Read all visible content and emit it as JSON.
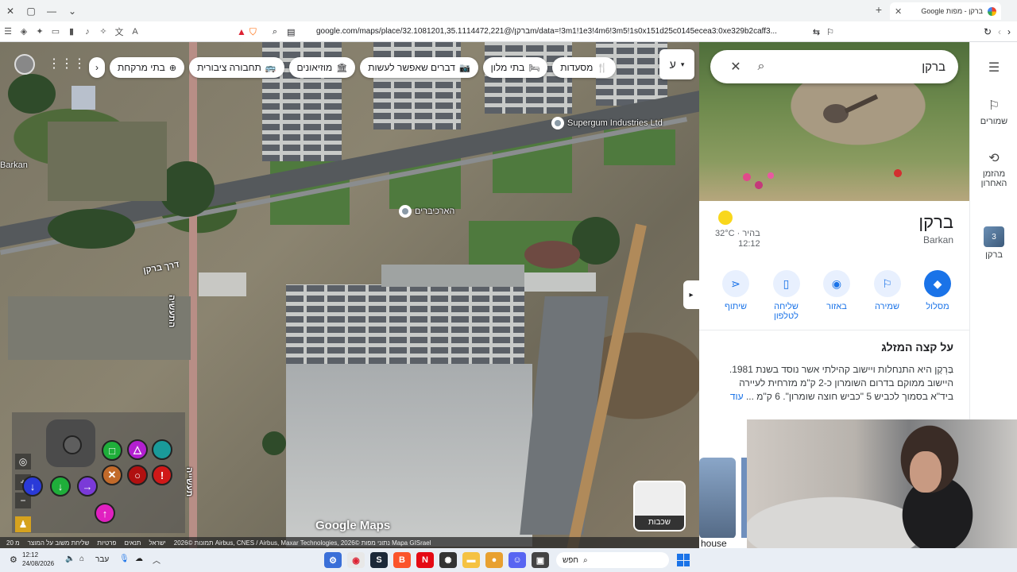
{
  "browser": {
    "tab_title": "ברקן - מפות Google",
    "url": "google.com/maps/place/ברקן/@32.1081201,35.1114472,221m/data=!3m1!1e3!4m6!3m5!1s0x151d25c0145ecea3:0xe329b2caff3..."
  },
  "map": {
    "chips": [
      {
        "label": "מסעדות",
        "icon": "fork-knife-icon"
      },
      {
        "label": "בתי מלון",
        "icon": "bed-icon"
      },
      {
        "label": "דברים שאפשר לעשות",
        "icon": "camera-icon"
      },
      {
        "label": "מוזיאונים",
        "icon": "museum-icon"
      },
      {
        "label": "תחבורה ציבורית",
        "icon": "bus-icon"
      },
      {
        "label": "בתי מרקחת",
        "icon": "pharmacy-icon"
      }
    ],
    "layer_toggle_label": "ע",
    "pois": [
      {
        "name": "Supergum Industries Ltd"
      },
      {
        "name": "הארכיברים"
      }
    ],
    "streets": {
      "main_road": "דרך ברקן",
      "side_street_1": "התעשיה",
      "side_street_2": "תעשייה",
      "left_edge_text": "Barkan"
    },
    "logo": "Google Maps",
    "layers_button_label": "שכבות",
    "footer": {
      "imagery": "תמונות ©2026 Airbus, CNES / Airbus, Maxar Technologies, נתוני מפות ©2026 Mapa GISrael",
      "israel": "ישראל",
      "terms": "תנאים",
      "privacy": "פרטיות",
      "feedback": "שליחת משוב על המוצר",
      "scale": "20 מ"
    }
  },
  "search": {
    "query": "ברקן"
  },
  "place": {
    "title": "ברקן",
    "subtitle": "Barkan",
    "weather_temp": "32°C",
    "weather_cond": "בהיר",
    "weather_time": "12:12",
    "actions": [
      {
        "label": "מסלול",
        "icon": "directions-icon",
        "primary": true
      },
      {
        "label": "שמירה",
        "icon": "bookmark-icon",
        "primary": false
      },
      {
        "label": "באזור",
        "icon": "nearby-icon",
        "primary": false
      },
      {
        "label": "שליחה לטלפון",
        "icon": "send-to-phone-icon",
        "primary": false
      },
      {
        "label": "שיתוף",
        "icon": "share-icon",
        "primary": false
      }
    ],
    "about_title": "על קצה המזלג",
    "about_text": "בַּרְקָן היא התנחלות ויישוב קהילתי אשר נוסד בשנת 1981. היישוב ממוקם בדרום השומרון כ-2 ק\"מ מזרחית לעיירה ביד\"א בסמוך לכביש 5 \"כביש חוצה שומרון\". 6 ק\"מ ...",
    "more_link": "עוד"
  },
  "rail": {
    "saved": "שמורים",
    "recent": "מהזמן האחרון",
    "recent_place": "ברקן",
    "badge": "3"
  },
  "photos": {
    "label": "house"
  },
  "taskbar": {
    "time": "12:12",
    "date": "24/08/2026",
    "lang": "עבר",
    "search_placeholder": "חפש"
  },
  "colors": {
    "accent": "#1a73e8",
    "pad_green": "#1fae3a",
    "pad_purple": "#b21fd0",
    "pad_teal": "#1a9a9a",
    "pad_red": "#b01010",
    "pad_orange": "#c26a2a",
    "pad_magenta": "#e020c0",
    "pad_blue": "#2a3ad8"
  }
}
